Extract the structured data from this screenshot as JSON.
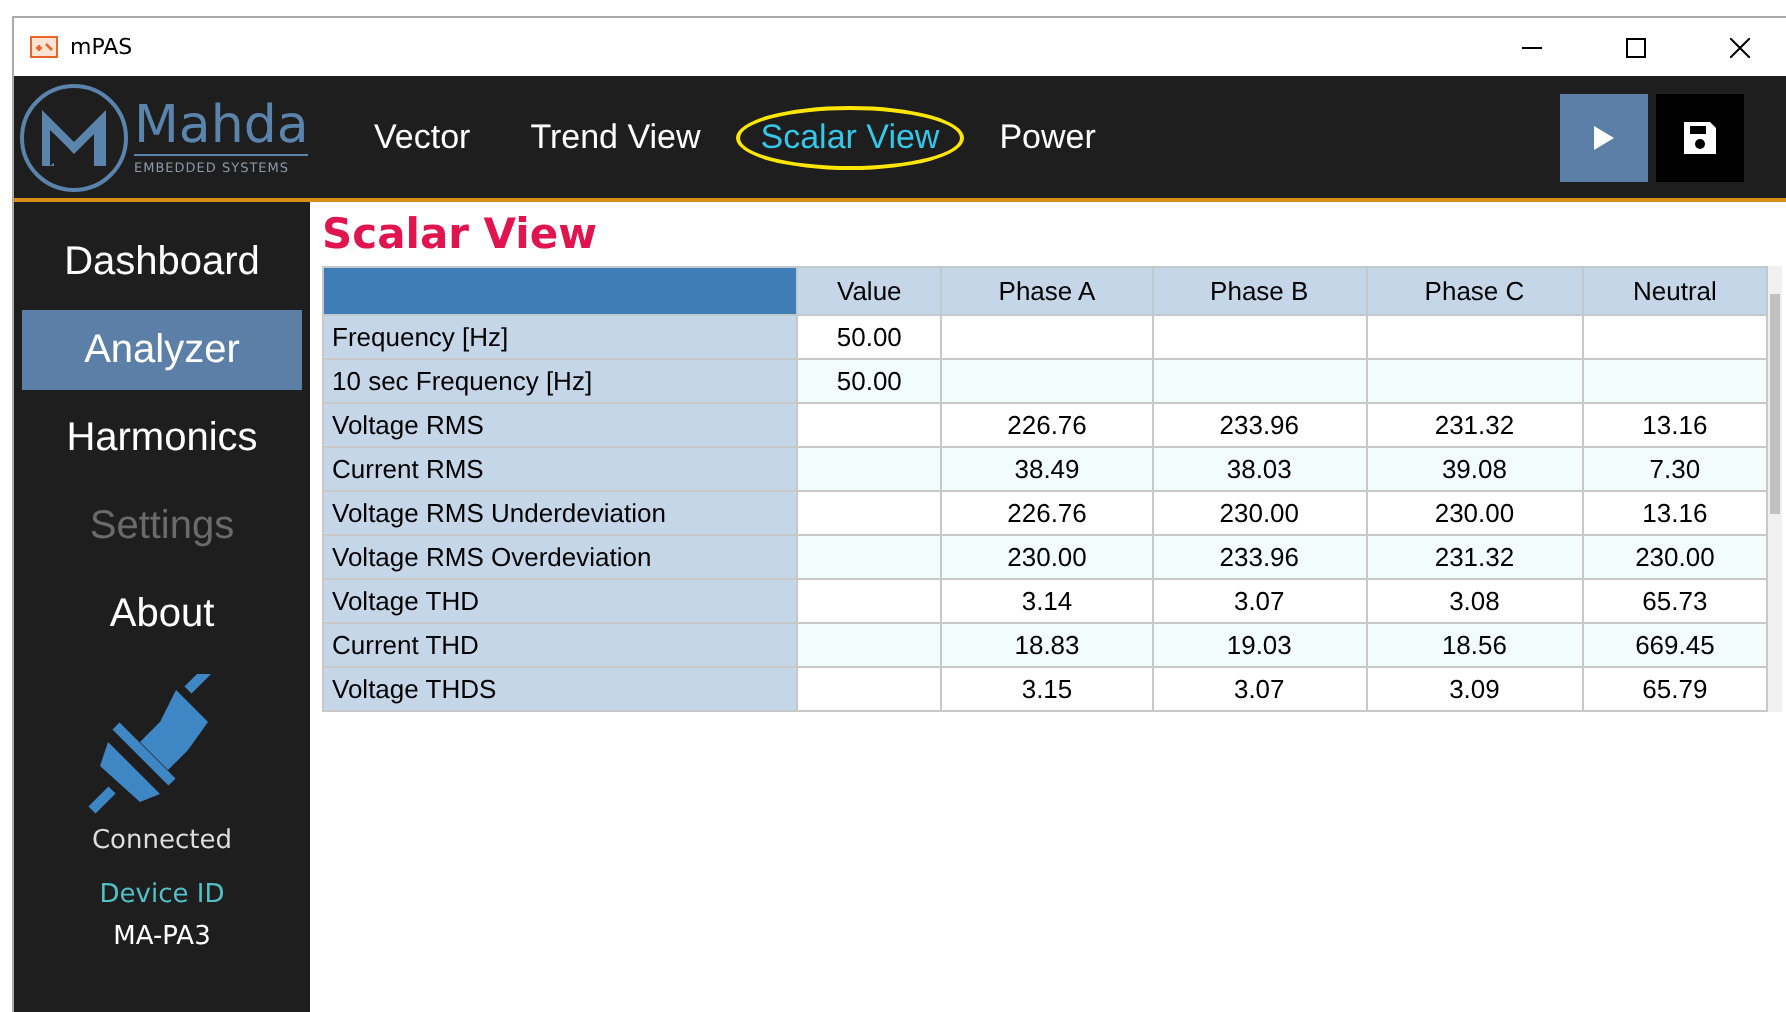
{
  "window": {
    "title": "mPAS"
  },
  "logo": {
    "brand": "Mahda",
    "tagline": "EMBEDDED SYSTEMS"
  },
  "tabs": [
    {
      "label": "Vector",
      "selected": false
    },
    {
      "label": "Trend View",
      "selected": false
    },
    {
      "label": "Scalar View",
      "selected": true
    },
    {
      "label": "Power",
      "selected": false
    }
  ],
  "sidebar": {
    "items": [
      {
        "label": "Dashboard",
        "selected": false,
        "disabled": false
      },
      {
        "label": "Analyzer",
        "selected": true,
        "disabled": false
      },
      {
        "label": "Harmonics",
        "selected": false,
        "disabled": false
      },
      {
        "label": "Settings",
        "selected": false,
        "disabled": true
      },
      {
        "label": "About",
        "selected": false,
        "disabled": false
      }
    ],
    "status": "Connected",
    "device_id_label": "Device ID",
    "device_id": "MA-PA3"
  },
  "page_title": "Scalar View",
  "table": {
    "columns": [
      "Value",
      "Phase A",
      "Phase B",
      "Phase C",
      "Neutral"
    ],
    "rows": [
      {
        "label": "Frequency [Hz]",
        "cells": [
          "50.00",
          null,
          null,
          null,
          null
        ]
      },
      {
        "label": "10 sec Frequency [Hz]",
        "cells": [
          "50.00",
          null,
          null,
          null,
          null
        ]
      },
      {
        "label": "Voltage RMS",
        "cells": [
          null,
          "226.76",
          "233.96",
          "231.32",
          "13.16"
        ]
      },
      {
        "label": "Current RMS",
        "cells": [
          null,
          "38.49",
          "38.03",
          "39.08",
          "7.30"
        ]
      },
      {
        "label": "Voltage RMS Underdeviation",
        "cells": [
          null,
          "226.76",
          "230.00",
          "230.00",
          "13.16"
        ]
      },
      {
        "label": "Voltage RMS Overdeviation",
        "cells": [
          null,
          "230.00",
          "233.96",
          "231.32",
          "230.00"
        ]
      },
      {
        "label": "Voltage THD",
        "cells": [
          null,
          "3.14",
          "3.07",
          "3.08",
          "65.73"
        ]
      },
      {
        "label": "Current THD",
        "cells": [
          null,
          "18.83",
          "19.03",
          "18.56",
          "669.45"
        ]
      },
      {
        "label": "Voltage THDS",
        "cells": [
          null,
          "3.15",
          "3.07",
          "3.09",
          "65.79"
        ]
      }
    ]
  }
}
